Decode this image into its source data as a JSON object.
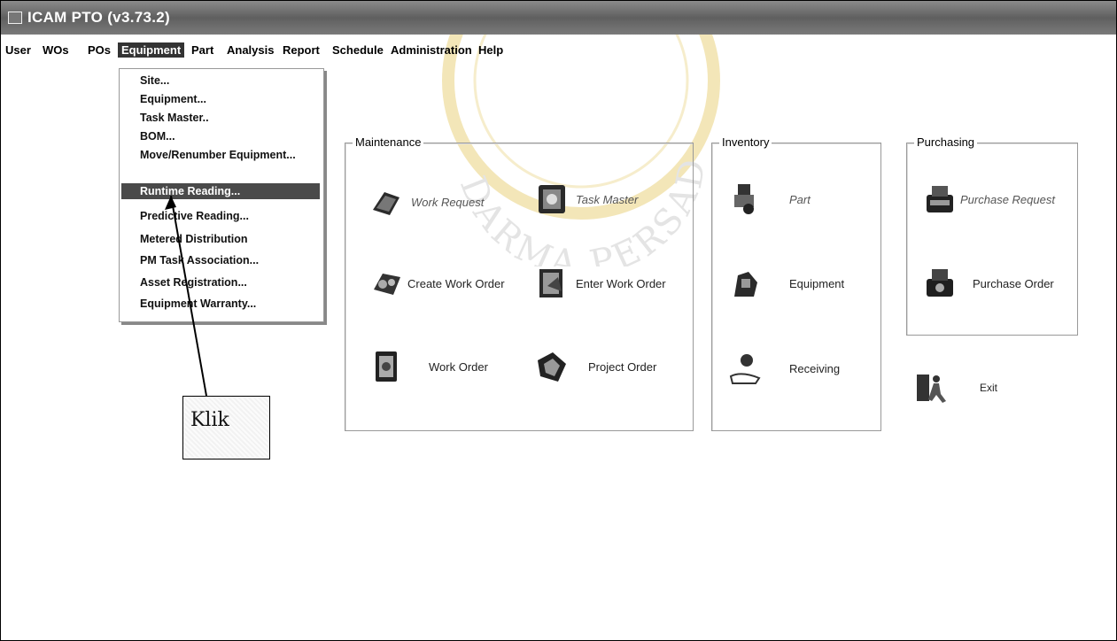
{
  "window": {
    "title": "ICAM PTO (v3.73.2)"
  },
  "menubar": {
    "items": [
      "User",
      "WOs",
      "POs",
      "Equipment",
      "Part",
      "Analysis",
      "Report",
      "Schedule",
      "Administration",
      "Help"
    ],
    "active": "Equipment"
  },
  "equipment_menu": {
    "items": [
      "Site...",
      "Equipment...",
      "Task Master..",
      "BOM...",
      "Move/Renumber Equipment...",
      "Runtime Reading...",
      "Predictive Reading...",
      "Metered Distribution",
      "PM Task Association...",
      "Asset Registration...",
      "Equipment Warranty..."
    ],
    "selected": "Runtime Reading..."
  },
  "maintenance": {
    "title": "Maintenance",
    "work_request": "Work Request",
    "task_master": "Task Master",
    "create_work_order": "Create Work Order",
    "enter_work_order": "Enter Work Order",
    "work_order": "Work Order",
    "project_order": "Project Order"
  },
  "inventory": {
    "title": "Inventory",
    "part": "Part",
    "equipment": "Equipment",
    "receiving": "Receiving"
  },
  "purchasing": {
    "title": "Purchasing",
    "purchase_request": "Purchase Request",
    "purchase_order": "Purchase Order"
  },
  "exit_label": "Exit",
  "annotation": {
    "label": "Klik"
  },
  "watermark": {
    "text": "DARMA PERSADA"
  },
  "icons": [
    "work-request-icon",
    "task-master-icon",
    "create-work-order-icon",
    "enter-work-order-icon",
    "work-order-icon",
    "project-order-icon",
    "part-icon",
    "equipment-icon",
    "receiving-icon",
    "purchase-request-icon",
    "purchase-order-icon",
    "exit-icon"
  ]
}
